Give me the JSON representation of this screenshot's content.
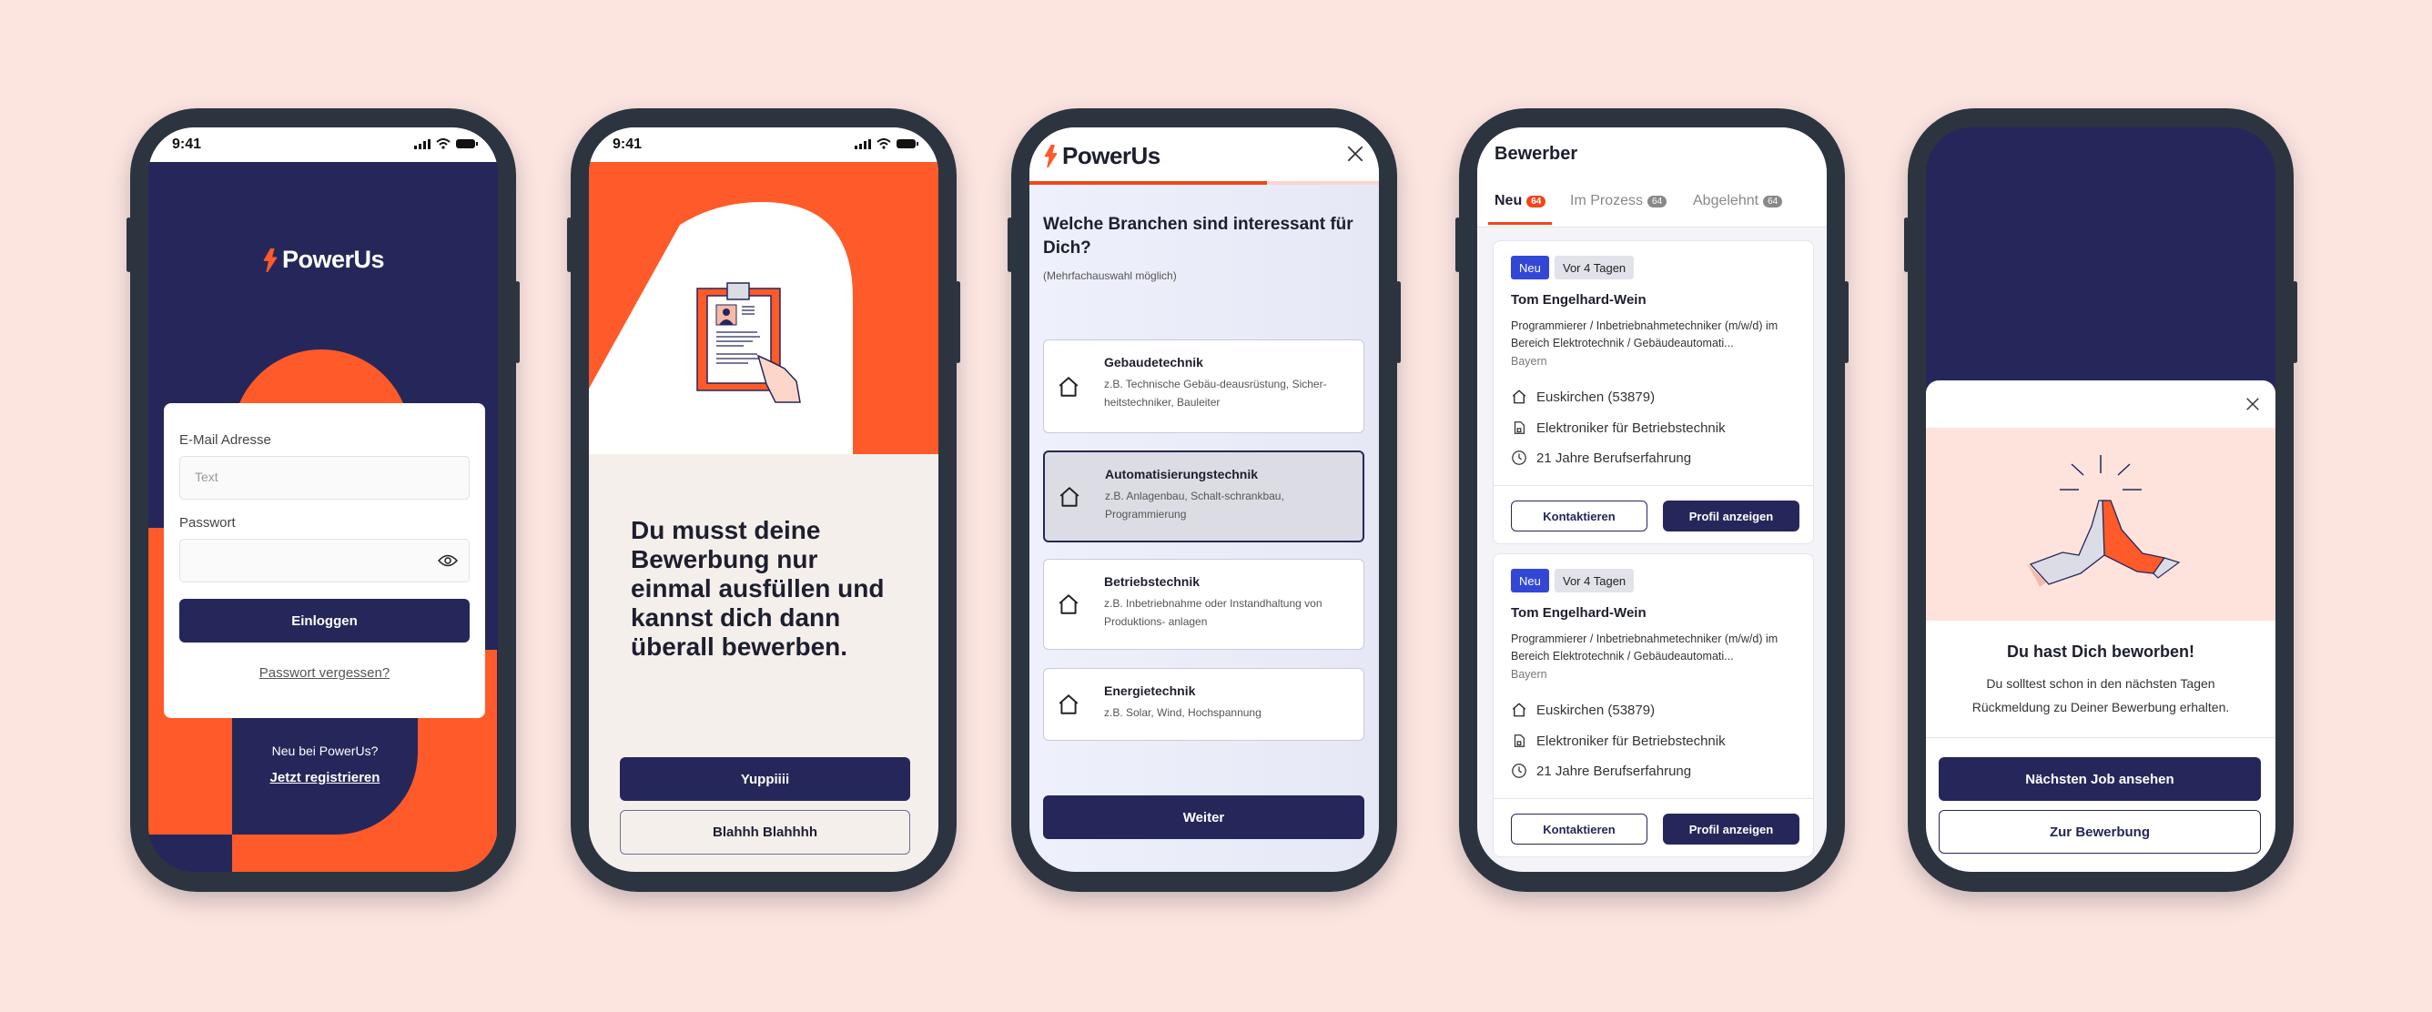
{
  "colors": {
    "navy": "#25275a",
    "orange": "#ff5a29",
    "background": "#fce4df",
    "frame": "#2c3440"
  },
  "brand": "PowerUs",
  "status_time": "9:41",
  "login": {
    "email_label": "E-Mail Adresse",
    "email_placeholder": "Text",
    "password_label": "Passwort",
    "login_button": "Einloggen",
    "forgot": "Passwort vergessen?",
    "new_text": "Neu bei PowerUs?",
    "register": "Jetzt registrieren"
  },
  "onboarding": {
    "headline": "Du musst deine Bewerbung nur einmal ausfüllen und kannst dich dann überall bewerben.",
    "primary": "Yuppiiii",
    "secondary": "Blahhh  Blahhhh"
  },
  "branches": {
    "progress": 0.68,
    "title": "Welche Branchen sind interessant für Dich?",
    "subtitle": "(Mehrfachauswahl möglich)",
    "options": [
      {
        "title": "Gebaudetechnik",
        "desc": "z.B. Technische Gebäu-deausrüstung, Sicher-heitstechniker, Bauleiter",
        "selected": false
      },
      {
        "title": "Automatisierungstechnik",
        "desc": "z.B. Anlagenbau, Schalt-schrankbau, Programmierung",
        "selected": true
      },
      {
        "title": "Betriebstechnik",
        "desc": "z.B. Inbetriebnahme oder Instandhaltung von Produktions- anlagen",
        "selected": false
      },
      {
        "title": "Energietechnik",
        "desc": "z.B. Solar, Wind, Hochspannung",
        "selected": false
      }
    ],
    "next": "Weiter"
  },
  "applicants": {
    "title": "Bewerber",
    "tabs": [
      {
        "label": "Neu",
        "count": "64",
        "active": true
      },
      {
        "label": "Im Prozess",
        "count": "64",
        "active": false
      },
      {
        "label": "Abgelehnt",
        "count": "64",
        "active": false
      }
    ],
    "cards": [
      {
        "badge": "Neu",
        "age": "Vor 4 Tagen",
        "name": "Tom Engelhard-Wein",
        "job": "Programmierer / Inbetriebnahmetechniker (m/w/d) im Bereich Elektrotechnik / Gebäudeautomati...",
        "region": "Bayern",
        "location": "Euskirchen (53879)",
        "qualification": "Elektroniker für Betriebstechnik",
        "experience": "21 Jahre Berufserfahrung",
        "contact": "Kontaktieren",
        "profile": "Profil anzeigen"
      },
      {
        "badge": "Neu",
        "age": "Vor 4 Tagen",
        "name": "Tom Engelhard-Wein",
        "job": "Programmierer / Inbetriebnahmetechniker (m/w/d) im Bereich Elektrotechnik / Gebäudeautomati...",
        "region": "Bayern",
        "location": "Euskirchen (53879)",
        "qualification": "Elektroniker für Betriebstechnik",
        "experience": "21 Jahre Berufserfahrung",
        "contact": "Kontaktieren",
        "profile": "Profil anzeigen"
      }
    ]
  },
  "success": {
    "title": "Du hast Dich beworben!",
    "body": "Du solltest schon in den nächsten Tagen Rückmeldung zu Deiner Bewerbung erhalten.",
    "primary": "Nächsten Job ansehen",
    "secondary": "Zur Bewerbung"
  }
}
